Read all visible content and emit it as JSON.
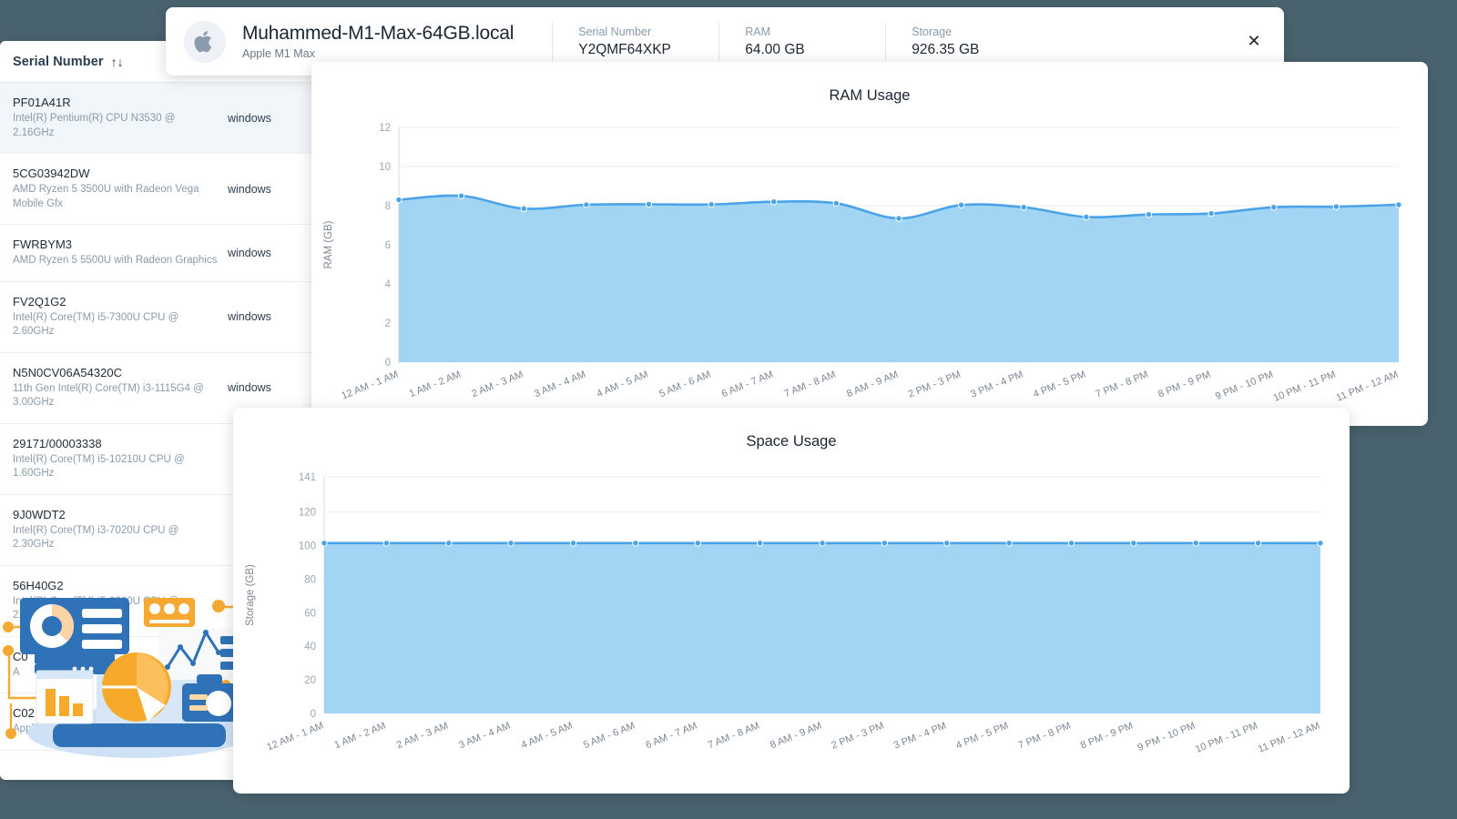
{
  "background_color": "#4a646f",
  "device_table": {
    "column_header": "Serial Number",
    "sort_icon": "sort-arrows-icon",
    "rows": [
      {
        "serial": "PF01A41R",
        "cpu": "Intel(R) Pentium(R) CPU N3530 @ 2.16GHz",
        "os": "windows",
        "selected": true
      },
      {
        "serial": "5CG03942DW",
        "cpu": "AMD Ryzen 5 3500U with Radeon Vega Mobile Gfx",
        "os": "windows",
        "selected": false
      },
      {
        "serial": "FWRBYM3",
        "cpu": "AMD Ryzen 5 5500U with Radeon Graphics",
        "os": "windows",
        "selected": false
      },
      {
        "serial": "FV2Q1G2",
        "cpu": "Intel(R) Core(TM) i5-7300U CPU @ 2.60GHz",
        "os": "windows",
        "selected": false
      },
      {
        "serial": "N5N0CV06A54320C",
        "cpu": "11th Gen Intel(R) Core(TM) i3-1115G4 @ 3.00GHz",
        "os": "windows",
        "selected": false
      },
      {
        "serial": "29171/00003338",
        "cpu": "Intel(R) Core(TM) i5-10210U CPU @ 1.60GHz",
        "os": "",
        "selected": false
      },
      {
        "serial": "9J0WDT2",
        "cpu": "Intel(R) Core(TM) i3-7020U CPU @ 2.30GHz",
        "os": "",
        "selected": false
      },
      {
        "serial": "56H40G2",
        "cpu": "Intel(R) Core(TM) i5-6300U CPU @ 2.40GHz",
        "os": "",
        "selected": false
      },
      {
        "serial": "C0",
        "cpu": "A",
        "os": "",
        "selected": false
      },
      {
        "serial": "C02",
        "cpu": "Appl",
        "os": "",
        "selected": false
      }
    ]
  },
  "device_header": {
    "icon": "apple-logo-icon",
    "hostname": "Muhammed-M1-Max-64GB.local",
    "model": "Apple M1 Max",
    "stats": [
      {
        "label": "Serial Number",
        "value": "Y2QMF64XKP"
      },
      {
        "label": "RAM",
        "value": "64.00 GB"
      },
      {
        "label": "Storage",
        "value": "926.35 GB"
      }
    ],
    "close_label": "✕"
  },
  "chart_data": [
    {
      "id": "ram",
      "type": "area",
      "title": "RAM Usage",
      "xlabel": "",
      "ylabel": "RAM (GB)",
      "ylim": [
        0,
        12
      ],
      "yticks": [
        0,
        2,
        4,
        6,
        8,
        10,
        12
      ],
      "grid": true,
      "legend": "none",
      "line_color": "#4aa3e8",
      "fill_color": "#9dd3f3",
      "categories": [
        "12 AM - 1 AM",
        "1 AM - 2 AM",
        "2 AM - 3 AM",
        "3 AM - 4 AM",
        "4 AM - 5 AM",
        "5 AM - 6 AM",
        "6 AM - 7 AM",
        "7 AM - 8 AM",
        "8 AM - 9 AM",
        "2 PM - 3 PM",
        "3 PM - 4 PM",
        "4 PM - 5 PM",
        "7 PM - 8 PM",
        "8 PM - 9 PM",
        "9 PM - 10 PM",
        "10 PM - 11 PM",
        "11 PM - 12 AM"
      ],
      "values": [
        8.3,
        8.5,
        7.85,
        8.05,
        8.07,
        8.06,
        8.2,
        8.12,
        7.35,
        8.03,
        7.92,
        7.42,
        7.55,
        7.6,
        7.92,
        7.95,
        8.05
      ]
    },
    {
      "id": "space",
      "type": "area",
      "title": "Space Usage",
      "xlabel": "",
      "ylabel": "Storage (GB)",
      "ylim": [
        0,
        141
      ],
      "yticks": [
        0,
        20,
        40,
        60,
        80,
        100,
        120,
        141
      ],
      "grid": true,
      "legend": "none",
      "line_color": "#4aa3e8",
      "fill_color": "#9dd3f3",
      "categories": [
        "12 AM - 1 AM",
        "1 AM - 2 AM",
        "2 AM - 3 AM",
        "3 AM - 4 AM",
        "4 AM - 5 AM",
        "5 AM - 6 AM",
        "6 AM - 7 AM",
        "7 AM - 8 AM",
        "8 AM - 9 AM",
        "2 PM - 3 PM",
        "3 PM - 4 PM",
        "4 PM - 5 PM",
        "7 PM - 8 PM",
        "8 PM - 9 PM",
        "9 PM - 10 PM",
        "10 PM - 11 PM",
        "11 PM - 12 AM"
      ],
      "values": [
        101.5,
        101.5,
        101.5,
        101.5,
        101.5,
        101.5,
        101.5,
        101.5,
        101.5,
        101.5,
        101.5,
        101.5,
        101.5,
        101.5,
        101.5,
        101.5,
        101.5
      ]
    }
  ]
}
